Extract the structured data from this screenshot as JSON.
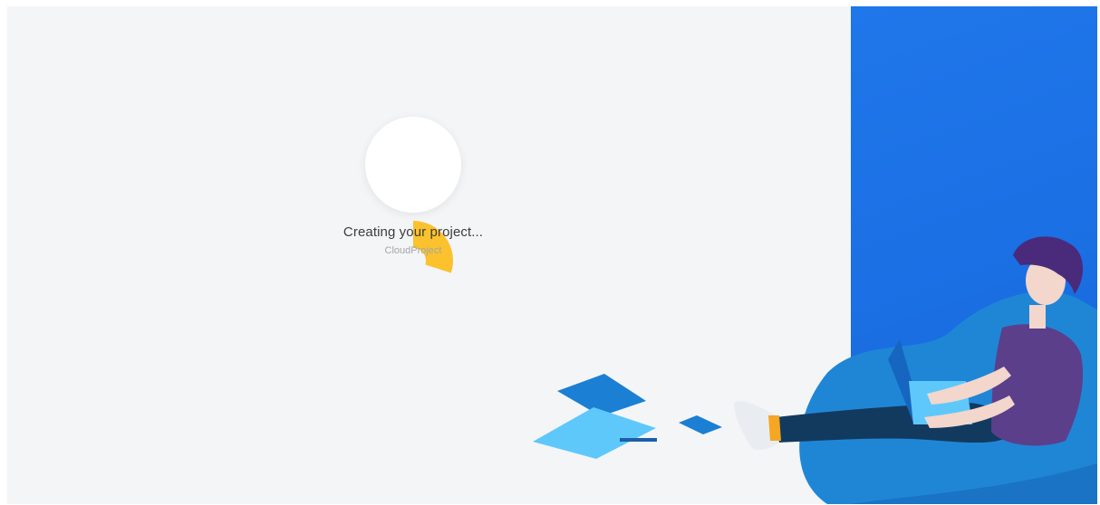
{
  "loader": {
    "progress": 0.3,
    "track_color": "#ffffff",
    "fill_color": "#fbc22d"
  },
  "status": {
    "title": "Creating your project...",
    "project_name": "CloudProject"
  },
  "colors": {
    "background": "#f4f5f7",
    "panel_blue": "#1f77ea"
  },
  "illustration": {
    "icon": "person-with-laptop-on-beanbag-illustration"
  }
}
